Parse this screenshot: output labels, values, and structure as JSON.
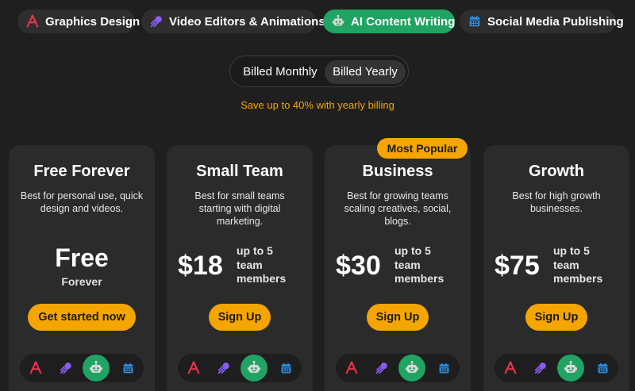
{
  "tabs": [
    {
      "label": "Graphics Design",
      "icon": "design-icon",
      "active": false
    },
    {
      "label": "Video Editors & Animations",
      "icon": "comet-icon",
      "active": false
    },
    {
      "label": "AI Content Writing",
      "icon": "robot-icon",
      "active": true
    },
    {
      "label": "Social Media Publishing",
      "icon": "calendar-icon",
      "active": false
    }
  ],
  "billing": {
    "monthly_label": "Billed Monthly",
    "yearly_label": "Billed Yearly",
    "selected": "Billed Yearly",
    "save_note": "Save up to 40% with yearly billing"
  },
  "plans": [
    {
      "name": "Free Forever",
      "description": "Best for personal use, quick design and videos.",
      "price": "Free",
      "price_sub": "Forever",
      "cta": "Get started now"
    },
    {
      "name": "Small Team",
      "description": "Best for small teams starting with digital marketing.",
      "price": "$18",
      "price_note": "up to 5 team members",
      "cta": "Sign Up"
    },
    {
      "name": "Business",
      "badge": "Most Popular",
      "description": "Best for growing teams scaling creatives, social, blogs.",
      "price": "$30",
      "price_note": "up to 5 team members",
      "cta": "Sign Up"
    },
    {
      "name": "Growth",
      "description": "Best for high growth businesses.",
      "price": "$75",
      "price_note": "up to 5 team members",
      "cta": "Sign Up"
    }
  ],
  "colors": {
    "background": "#1f1f1f",
    "card": "#2b2b2b",
    "accent_green": "#1fa463",
    "accent_orange": "#f5a500",
    "design_icon": "#e8334a",
    "comet_icon": "#8a5cf6",
    "calendar_icon": "#2f8fe0"
  }
}
